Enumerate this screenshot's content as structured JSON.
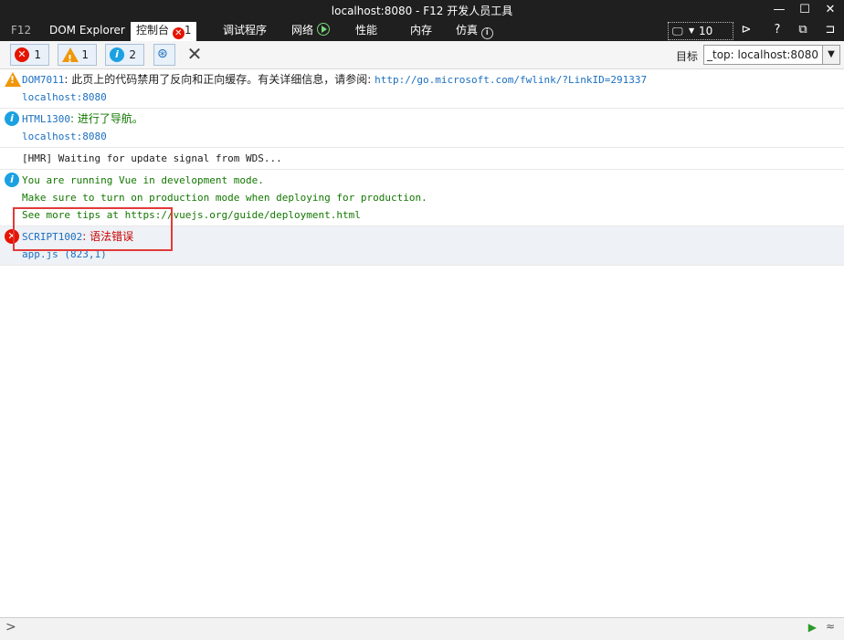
{
  "window": {
    "title": "localhost:8080 - F12 开发人员工具",
    "controls": [
      "—",
      "☐",
      "✕"
    ]
  },
  "tabs": {
    "f12": "F12",
    "dom_explorer": "DOM Explorer",
    "console": "控制台",
    "console_error_count": "1",
    "debugger": "调试程序",
    "network": "网络",
    "performance": "性能",
    "memory": "内存",
    "emulation": "仿真",
    "doc_mode": "10"
  },
  "toolbar": {
    "errors_count": "1",
    "warnings_count": "1",
    "messages_count": "2",
    "clear_glyph": "✕",
    "target_label": "目标",
    "target_value": "_top: localhost:8080"
  },
  "console": {
    "messages": [
      {
        "type": "warning",
        "code": "DOM7011",
        "text": ": 此页上的代码禁用了反向和正向缓存。有关详细信息，请参阅: ",
        "link": "http://go.microsoft.com/fwlink/?LinkID=291337",
        "source": "localhost:8080"
      },
      {
        "type": "info",
        "code": "HTML1300",
        "text": ": 进行了导航。",
        "source": "localhost:8080"
      },
      {
        "type": "log",
        "text": "[HMR] Waiting for update signal from WDS..."
      },
      {
        "type": "info",
        "lines": [
          "You are running Vue in development mode.",
          "Make sure to turn on production mode when deploying for production.",
          "See more tips at https://vuejs.org/guide/deployment.html"
        ]
      },
      {
        "type": "error",
        "code": "SCRIPT1002",
        "text": ": 语法错误",
        "source": "app.js (823,1)"
      }
    ]
  },
  "bottom": {
    "prompt": ">",
    "run_glyph": "▶",
    "expand_glyph": "≈"
  },
  "colors": {
    "titlebar": "#1f1f1f",
    "error": "#e51400",
    "warning": "#f09609",
    "info": "#1ba1e2",
    "link": "#1a6fc0",
    "info_text": "#127700",
    "error_text": "#cc0000",
    "highlight_box": "#e23a3a"
  },
  "icons": [
    "error-icon",
    "warning-icon",
    "info-icon",
    "clear-icon",
    "play-icon",
    "dropdown-arrow-icon"
  ]
}
